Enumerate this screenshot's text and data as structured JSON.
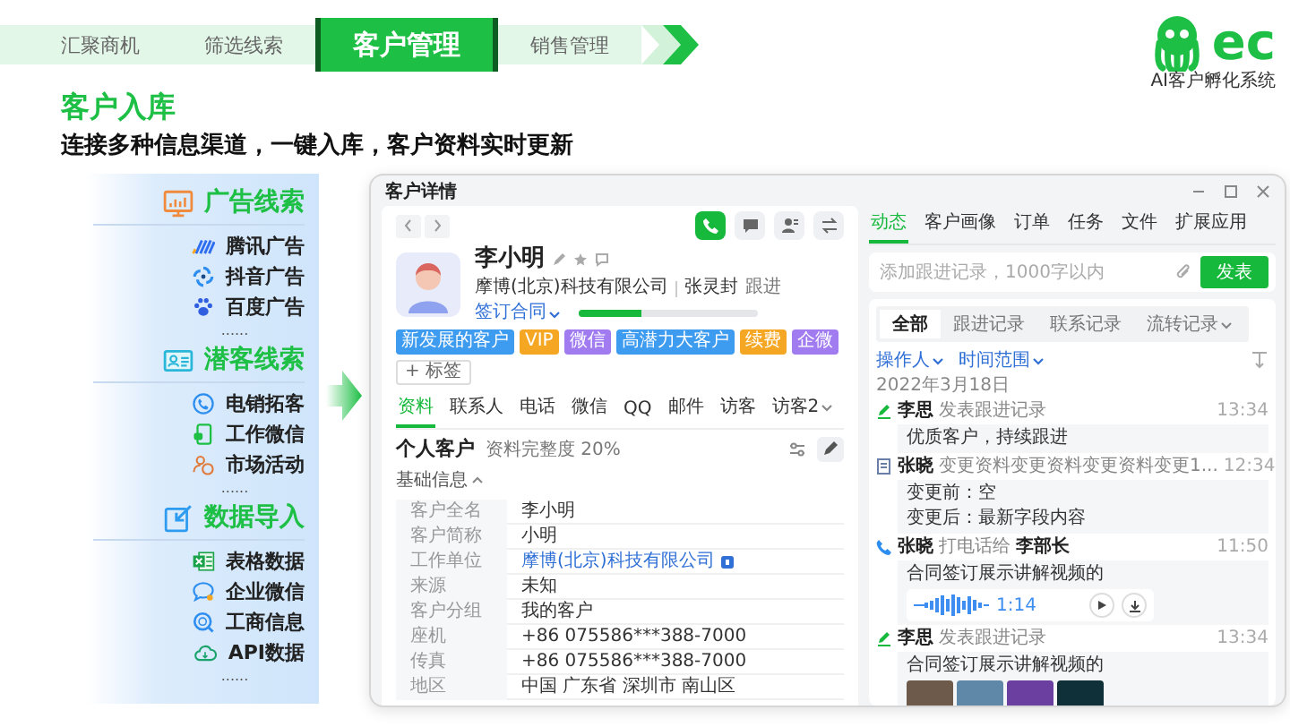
{
  "steps": [
    {
      "label": "汇聚商机",
      "selected": false
    },
    {
      "label": "筛选线索",
      "selected": false
    },
    {
      "label": "客户管理",
      "selected": true
    },
    {
      "label": "销售管理",
      "selected": false
    }
  ],
  "logo": {
    "mark": "ec",
    "tagline": "AI客户孵化系统"
  },
  "heading": "客户入库",
  "subtitle": "连接多种信息渠道，一键入库，客户资料实时更新",
  "sources": [
    {
      "title": "广告线索",
      "items": [
        "腾讯广告",
        "抖音广告",
        "百度广告"
      ],
      "more": "......"
    },
    {
      "title": "潜客线索",
      "items": [
        "电销拓客",
        "工作微信",
        "市场活动"
      ],
      "more": "......"
    },
    {
      "title": "数据导入",
      "items": [
        "表格数据",
        "企业微信",
        "工商信息",
        "API数据"
      ],
      "more": "......"
    }
  ],
  "window": {
    "title": "客户详情"
  },
  "profile": {
    "name": "李小明",
    "company": "摩博(北京)科技有限公司",
    "owner": "张灵封",
    "follow": "跟进",
    "stage": {
      "label": "签订合同",
      "level": 0.35
    }
  },
  "tags": [
    {
      "label": "新发展的客户",
      "color": "#3d9bf0"
    },
    {
      "label": "VIP",
      "color": "#f5a623"
    },
    {
      "label": "微信",
      "color": "#a17cf0"
    },
    {
      "label": "高潜力大客户",
      "color": "#3d9bf0"
    },
    {
      "label": "续费",
      "color": "#f5a623"
    },
    {
      "label": "企微",
      "color": "#a17cf0"
    }
  ],
  "add_tag": "+ 标签",
  "profile_tabs": [
    {
      "label": "资料",
      "selected": true,
      "dropdown": false
    },
    {
      "label": "联系人",
      "selected": false,
      "dropdown": false
    },
    {
      "label": "电话",
      "selected": false,
      "dropdown": false
    },
    {
      "label": "微信",
      "selected": false,
      "dropdown": false
    },
    {
      "label": "QQ",
      "selected": false,
      "dropdown": false
    },
    {
      "label": "邮件",
      "selected": false,
      "dropdown": false
    },
    {
      "label": "访客",
      "selected": false,
      "dropdown": false
    },
    {
      "label": "访客2",
      "selected": false,
      "dropdown": true
    }
  ],
  "section": {
    "type": "个人客户",
    "completeness": "资料完整度 20%",
    "group": "基础信息"
  },
  "fields": [
    {
      "label": "客户全名",
      "value": "李小明",
      "kind": "text"
    },
    {
      "label": "客户简称",
      "value": "小明",
      "kind": "text"
    },
    {
      "label": "工作单位",
      "value": "摩博(北京)科技有限公司",
      "kind": "link"
    },
    {
      "label": "来源",
      "value": "未知",
      "kind": "text"
    },
    {
      "label": "客户分组",
      "value": "我的客户",
      "kind": "text"
    },
    {
      "label": "座机",
      "value": "+86 075586***388-7000",
      "kind": "text"
    },
    {
      "label": "传真",
      "value": "+86 075586***388-7000",
      "kind": "text"
    },
    {
      "label": "地区",
      "value": "中国 广东省 深圳市 南山区",
      "kind": "text"
    }
  ],
  "activity_tabs": [
    {
      "label": "动态",
      "selected": true
    },
    {
      "label": "客户画像",
      "selected": false
    },
    {
      "label": "订单",
      "selected": false
    },
    {
      "label": "任务",
      "selected": false
    },
    {
      "label": "文件",
      "selected": false
    },
    {
      "label": "扩展应用",
      "selected": false
    }
  ],
  "composer": {
    "placeholder": "添加跟进记录，1000字以内",
    "button": "发表"
  },
  "record_tabs": [
    {
      "label": "全部",
      "selected": true,
      "dropdown": false
    },
    {
      "label": "跟进记录",
      "selected": false,
      "dropdown": false
    },
    {
      "label": "联系记录",
      "selected": false,
      "dropdown": false
    },
    {
      "label": "流转记录",
      "selected": false,
      "dropdown": true
    }
  ],
  "filters": [
    "操作人",
    "时间范围"
  ],
  "date": "2022年3月18日",
  "records": [
    {
      "kind": "note",
      "author": "李思",
      "action": "发表跟进记录",
      "time": "13:34",
      "lines": [
        "优质客户，持续跟进"
      ]
    },
    {
      "kind": "change",
      "author": "张晓",
      "action": "变更资料变更资料变更资料变更1...",
      "time": "12:34",
      "lines": [
        "变更前：空",
        "变更后：最新字段内容"
      ]
    },
    {
      "kind": "call",
      "author": "张晓",
      "action": "打电话给",
      "target": "李部长",
      "time": "11:50",
      "lines": [
        "合同签订展示讲解视频的"
      ],
      "attachment": {
        "kind": "audio",
        "duration": "1:14"
      }
    },
    {
      "kind": "note",
      "author": "李思",
      "action": "发表跟进记录",
      "time": "13:34",
      "lines": [
        "合同签订展示讲解视频的"
      ],
      "attachment": {
        "kind": "photos"
      }
    }
  ]
}
